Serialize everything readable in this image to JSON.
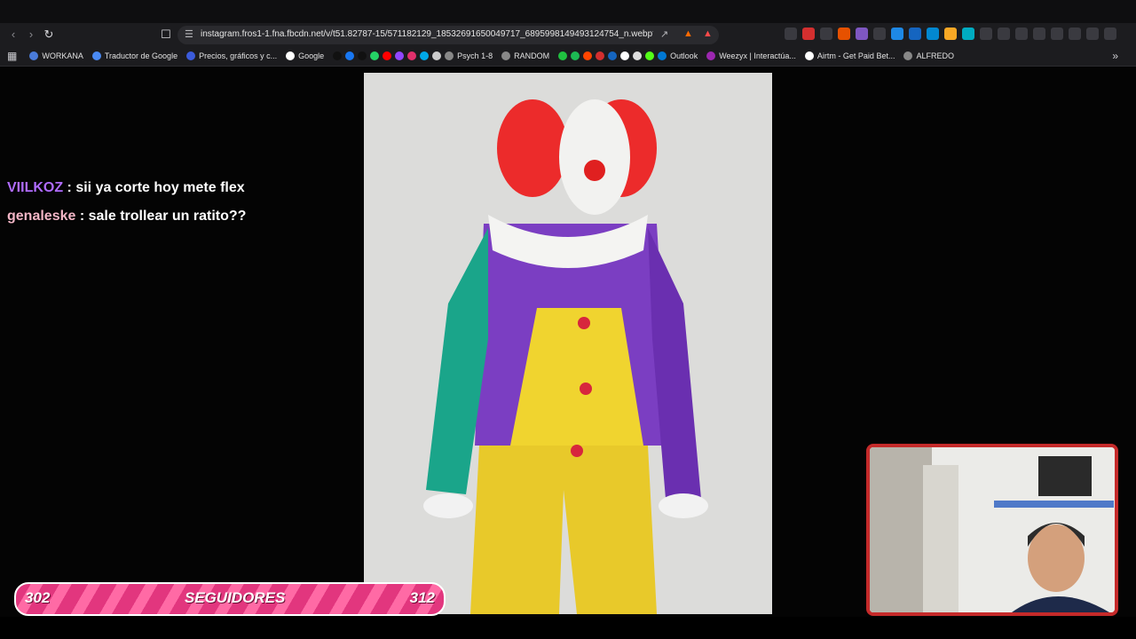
{
  "browser": {
    "url": "instagram.fros1-1.fna.fbcdn.net/v/t51.82787-15/571182129_18532691650049717_6895998149493124754_n.webp?_nc_cat...",
    "icons": [
      "back-icon",
      "forward-icon",
      "reload-icon",
      "bookmark-icon"
    ]
  },
  "bookmarks": [
    {
      "label": "WORKANA",
      "color": "#4a7bd9"
    },
    {
      "label": "Traductor de Google",
      "color": "#4a8af4"
    },
    {
      "label": "Precios, gráficos y c...",
      "color": "#3b5bdb"
    },
    {
      "label": "Google",
      "color": "#ffffff"
    },
    {
      "label": "",
      "color": "#111111"
    },
    {
      "label": "",
      "color": "#1877f2"
    },
    {
      "label": "",
      "color": "#111111"
    },
    {
      "label": "",
      "color": "#25d366"
    },
    {
      "label": "",
      "color": "#ff0000"
    },
    {
      "label": "",
      "color": "#9146ff"
    },
    {
      "label": "",
      "color": "#e1306c"
    },
    {
      "label": "",
      "color": "#00a8e8"
    },
    {
      "label": "",
      "color": "#cccccc"
    },
    {
      "label": "Psych 1-8",
      "color": "#888888"
    },
    {
      "label": "RANDOM",
      "color": "#888888"
    },
    {
      "label": "",
      "color": "#20c040"
    },
    {
      "label": "",
      "color": "#1db954"
    },
    {
      "label": "",
      "color": "#ff4500"
    },
    {
      "label": "",
      "color": "#d32f2f"
    },
    {
      "label": "",
      "color": "#1565c0"
    },
    {
      "label": "",
      "color": "#ffffff"
    },
    {
      "label": "",
      "color": "#dddddd"
    },
    {
      "label": "",
      "color": "#53fc18"
    },
    {
      "label": "Outlook",
      "color": "#0078d4"
    },
    {
      "label": "Weezyx | Interactúa...",
      "color": "#9c27b0"
    },
    {
      "label": "Airtm - Get Paid Bet...",
      "color": "#ffffff"
    },
    {
      "label": "ALFREDO",
      "color": "#888888"
    }
  ],
  "chat": [
    {
      "user": "VIILKOZ",
      "message": " : sii ya corte hoy mete flex"
    },
    {
      "user": "genaleske",
      "message": " : sale trollear un ratito??"
    }
  ],
  "followers": {
    "current": "302",
    "label": "SEGUIDORES",
    "goal": "312",
    "progress": 0.0
  },
  "colors": {
    "accent": "#e2367e",
    "cam_border": "#c52a2a"
  }
}
